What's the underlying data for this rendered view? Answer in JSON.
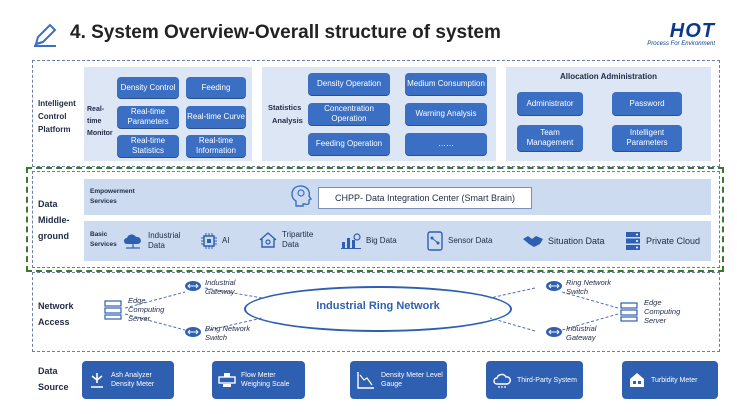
{
  "header": {
    "title": "4.  System Overview-Overall structure of system",
    "logo_main": "HOT",
    "logo_sub": "Process For Environment"
  },
  "intelligent_control": {
    "section_label": [
      "Intelligent",
      "Control",
      "Platform"
    ],
    "realtime_label": [
      "Real-",
      "time",
      "Monitor"
    ],
    "realtime_buttons": [
      "Density Control",
      "Feeding",
      "Real-time Parameters",
      "Real-time Curve",
      "Real-time Statistics",
      "Real-time Information"
    ],
    "stats_label": [
      "Statistics",
      "Analysis"
    ],
    "stats_buttons": [
      "Density Operation",
      "Medium Consumption",
      "Concentration Operation",
      "Warning Analysis",
      "Feeding Operation",
      "……"
    ],
    "allocation_title": "Allocation Administration",
    "allocation_buttons": [
      "Administrator",
      "Password",
      "Team Management",
      "Intelligent Parameters"
    ]
  },
  "data_middle": {
    "section_label": [
      "Data",
      "Middle-",
      "ground"
    ],
    "empowerment_label": [
      "Empowerment",
      "Services"
    ],
    "integration_center": "CHPP- Data Integration Center (Smart Brain)",
    "basic_label": [
      "Basic",
      "Services"
    ],
    "services": [
      {
        "label": "Industrial Data",
        "icon": "cloud-network-icon"
      },
      {
        "label": "AI",
        "icon": "chip-icon"
      },
      {
        "label": "Tripartite Data",
        "icon": "house-icon"
      },
      {
        "label": "Big Data",
        "icon": "bar-chart-icon"
      },
      {
        "label": "Sensor Data",
        "icon": "tablet-icon"
      },
      {
        "label": "Situation Data",
        "icon": "handshake-icon"
      },
      {
        "label": "Private Cloud",
        "icon": "server-icon"
      }
    ]
  },
  "network": {
    "section_label": [
      "Network",
      "Access"
    ],
    "ring_label": "Industrial Ring Network",
    "edge_server_left": "Edge Computing Server",
    "edge_server_right": "Edge Computing Server",
    "gateway_top_left": "Industrial Gateway",
    "switch_bottom_left": "Ring Network Switch",
    "switch_top_right": "Ring Network Switch",
    "gateway_bottom_right": "Industrial Gateway"
  },
  "data_source": {
    "section_label": [
      "Data",
      "Source"
    ],
    "items": [
      {
        "label": "Ash Analyzer Density Meter",
        "icon": "analyzer-icon"
      },
      {
        "label": "Flow Meter Weighing Scale",
        "icon": "flow-meter-icon"
      },
      {
        "label": "Density Meter Level Gauge",
        "icon": "gauge-icon"
      },
      {
        "label": "Third-Party System",
        "icon": "cloud-icon"
      },
      {
        "label": "Turbidity Meter",
        "icon": "building-icon"
      }
    ]
  },
  "colors": {
    "button_blue": "#3a6fc4",
    "panel_bg": "#dde6f5",
    "ring_blue": "#2d5fb3",
    "dashed_green": "#3b7a2e",
    "source_blue": "#2e5fb0"
  }
}
